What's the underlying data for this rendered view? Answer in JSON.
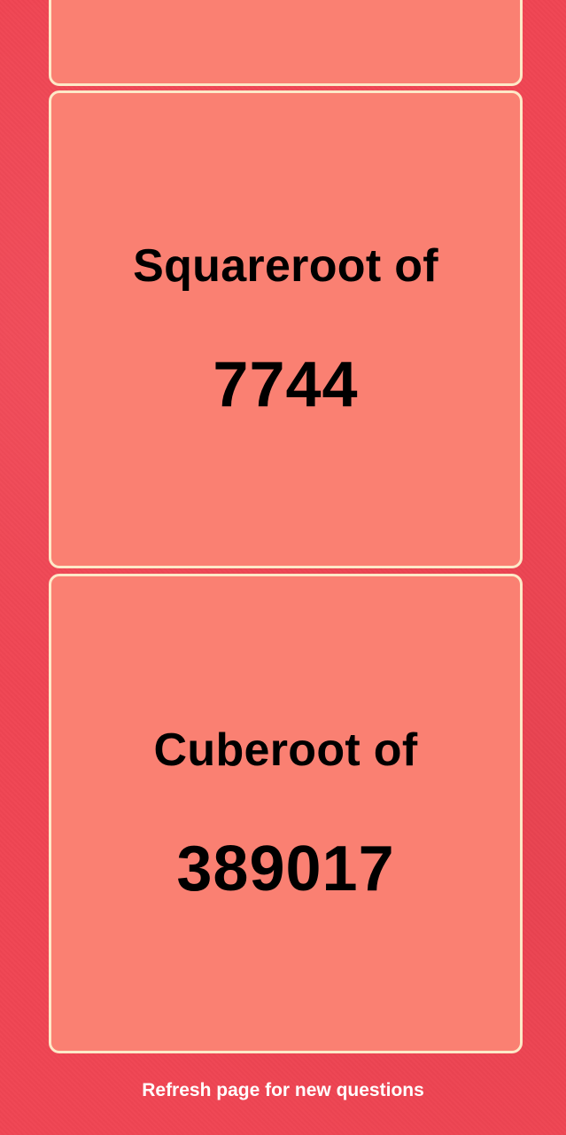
{
  "cards": [
    {
      "label": "",
      "number": ""
    },
    {
      "label": "Squareroot of",
      "number": "7744"
    },
    {
      "label": "Cuberoot of",
      "number": "389017"
    }
  ],
  "footer": {
    "text": "Refresh page for new questions"
  },
  "colors": {
    "background": "#f04553",
    "card_fill": "#fa8072",
    "card_border": "#fde9c8",
    "text": "#000000",
    "footer_text": "#ffffff"
  }
}
